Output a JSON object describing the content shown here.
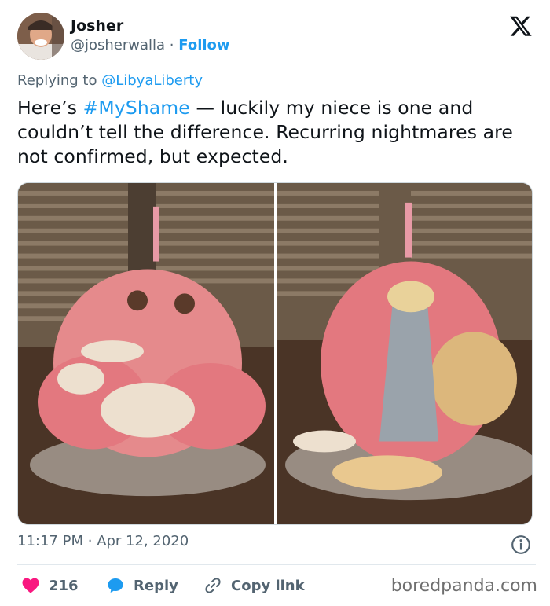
{
  "author": {
    "display_name": "Josher",
    "handle": "@josherwalla",
    "separator": "·",
    "follow_label": "Follow"
  },
  "reply": {
    "prefix": "Replying to",
    "mention": "@LibyaLiberty"
  },
  "tweet": {
    "text_before": "Here’s ",
    "hashtag": "#MyShame",
    "text_after": " — luckily my niece is one and couldn’t tell the difference. Recurring nightmares are not confirmed, but expected."
  },
  "media": {
    "images": [
      "cake-before-photo",
      "cake-after-photo"
    ]
  },
  "meta": {
    "time": "11:17 PM",
    "separator": "·",
    "date": "Apr 12, 2020"
  },
  "actions": {
    "like_count": "216",
    "reply_label": "Reply",
    "copy_link_label": "Copy link"
  },
  "watermark": "boredpanda.com",
  "colors": {
    "accent": "#1d9bf0",
    "like": "#f91880",
    "muted": "#536471",
    "text": "#0f1419"
  },
  "icons": [
    "x-logo-icon",
    "info-icon",
    "heart-icon",
    "reply-bubble-icon",
    "link-icon"
  ]
}
